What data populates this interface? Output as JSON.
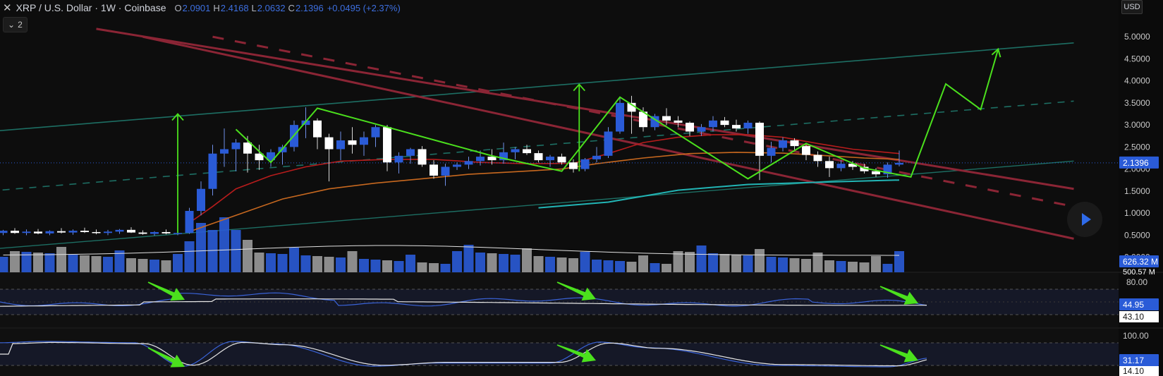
{
  "header": {
    "close_glyph": "✕",
    "symbol": "XRP / U.S. Dollar · 1W · Coinbase",
    "o_label": "O",
    "o_value": "2.0901",
    "h_label": "H",
    "h_value": "2.4168",
    "l_label": "L",
    "l_value": "2.0632",
    "c_label": "C",
    "c_value": "2.1396",
    "change": "+0.0495 (+2.37%)"
  },
  "indicators_toggle": {
    "count": "2",
    "icon": "chevron-down-icon"
  },
  "currency_button": "USD",
  "play_button_icon": "play-icon",
  "colors": {
    "bull": "#2a5bd7",
    "bear": "#ffffff",
    "pattern": "#4be01d",
    "ma_fast": "#b71c1c",
    "ma_slow": "#c7681f",
    "ma_long": "#22b5b5",
    "channel": "#8b2535",
    "support": "#1d6e63",
    "last_price": "#2a5bd7"
  },
  "chart_data": [
    {
      "type": "candlestick",
      "title": "XRP / U.S. Dollar · 1W · Coinbase",
      "y_ticks": [
        "5.0000",
        "4.5000",
        "4.0000",
        "3.5000",
        "3.0000",
        "2.5000",
        "2.0000",
        "1.5000",
        "1.0000",
        "0.5000",
        "0.0000"
      ],
      "ylim": [
        -0.2,
        5.2
      ],
      "last_price": "2.1396",
      "candles": [
        [
          0.55,
          0.62,
          0.5,
          0.6
        ],
        [
          0.6,
          0.66,
          0.53,
          0.55
        ],
        [
          0.55,
          0.63,
          0.5,
          0.58
        ],
        [
          0.58,
          0.64,
          0.52,
          0.54
        ],
        [
          0.54,
          0.61,
          0.5,
          0.59
        ],
        [
          0.59,
          0.66,
          0.54,
          0.56
        ],
        [
          0.56,
          0.63,
          0.51,
          0.6
        ],
        [
          0.6,
          0.67,
          0.55,
          0.57
        ],
        [
          0.57,
          0.63,
          0.52,
          0.55
        ],
        [
          0.55,
          0.62,
          0.5,
          0.58
        ],
        [
          0.58,
          0.64,
          0.53,
          0.62
        ],
        [
          0.62,
          0.68,
          0.55,
          0.56
        ],
        [
          0.56,
          0.61,
          0.51,
          0.53
        ],
        [
          0.53,
          0.59,
          0.49,
          0.57
        ],
        [
          0.57,
          0.63,
          0.52,
          0.54
        ],
        [
          0.54,
          0.6,
          0.5,
          0.55
        ],
        [
          0.55,
          1.12,
          0.53,
          1.05
        ],
        [
          1.05,
          1.72,
          0.95,
          1.55
        ],
        [
          1.55,
          2.55,
          1.4,
          2.35
        ],
        [
          2.35,
          2.92,
          2.05,
          2.45
        ],
        [
          2.45,
          2.68,
          1.95,
          2.6
        ],
        [
          2.6,
          2.75,
          1.92,
          2.35
        ],
        [
          2.35,
          2.55,
          1.98,
          2.2
        ],
        [
          2.2,
          2.45,
          2.05,
          2.38
        ],
        [
          2.38,
          2.55,
          2.1,
          2.5
        ],
        [
          2.5,
          3.1,
          2.4,
          3.0
        ],
        [
          3.0,
          3.4,
          2.7,
          3.1
        ],
        [
          3.1,
          3.15,
          2.45,
          2.72
        ],
        [
          2.72,
          2.8,
          1.72,
          2.45
        ],
        [
          2.45,
          2.85,
          2.2,
          2.65
        ],
        [
          2.65,
          2.95,
          2.35,
          2.55
        ],
        [
          2.55,
          2.85,
          2.3,
          2.72
        ],
        [
          2.72,
          3.0,
          2.5,
          2.95
        ],
        [
          2.95,
          3.0,
          1.95,
          2.15
        ],
        [
          2.15,
          2.38,
          1.9,
          2.3
        ],
        [
          2.3,
          2.48,
          2.12,
          2.45
        ],
        [
          2.45,
          2.52,
          2.05,
          2.1
        ],
        [
          2.1,
          2.2,
          1.78,
          1.85
        ],
        [
          1.85,
          2.12,
          1.62,
          2.05
        ],
        [
          2.05,
          2.15,
          1.98,
          2.1
        ],
        [
          2.1,
          2.28,
          2.0,
          2.18
        ],
        [
          2.18,
          2.42,
          2.08,
          2.28
        ],
        [
          2.28,
          2.45,
          2.1,
          2.2
        ],
        [
          2.2,
          2.6,
          2.12,
          2.38
        ],
        [
          2.38,
          2.5,
          2.22,
          2.45
        ],
        [
          2.45,
          2.55,
          2.32,
          2.36
        ],
        [
          2.36,
          2.42,
          2.15,
          2.2
        ],
        [
          2.2,
          2.32,
          2.05,
          2.28
        ],
        [
          2.28,
          2.35,
          2.1,
          2.15
        ],
        [
          2.15,
          2.22,
          1.92,
          2.0
        ],
        [
          2.0,
          2.25,
          1.95,
          2.22
        ],
        [
          2.22,
          2.5,
          2.15,
          2.3
        ],
        [
          2.3,
          2.95,
          2.25,
          2.85
        ],
        [
          2.85,
          3.62,
          2.8,
          3.5
        ],
        [
          3.5,
          3.66,
          2.8,
          3.3
        ],
        [
          3.3,
          3.4,
          2.85,
          2.95
        ],
        [
          2.95,
          3.25,
          2.88,
          3.2
        ],
        [
          3.2,
          3.38,
          3.0,
          3.1
        ],
        [
          3.1,
          3.2,
          2.95,
          3.05
        ],
        [
          3.05,
          3.08,
          2.75,
          2.85
        ],
        [
          2.85,
          3.02,
          2.75,
          2.95
        ],
        [
          2.95,
          3.2,
          2.85,
          3.1
        ],
        [
          3.1,
          3.18,
          2.95,
          3.0
        ],
        [
          3.0,
          3.12,
          2.85,
          2.92
        ],
        [
          2.92,
          3.1,
          2.8,
          3.05
        ],
        [
          3.05,
          3.08,
          1.75,
          2.3
        ],
        [
          2.3,
          2.62,
          2.15,
          2.48
        ],
        [
          2.48,
          2.72,
          2.4,
          2.65
        ],
        [
          2.65,
          2.7,
          2.42,
          2.52
        ],
        [
          2.52,
          2.55,
          2.2,
          2.32
        ],
        [
          2.32,
          2.4,
          2.05,
          2.18
        ],
        [
          2.18,
          2.28,
          1.82,
          2.02
        ],
        [
          2.02,
          2.2,
          1.95,
          2.12
        ],
        [
          2.12,
          2.18,
          1.98,
          2.05
        ],
        [
          2.05,
          2.12,
          1.9,
          1.95
        ],
        [
          1.95,
          2.02,
          1.82,
          1.88
        ],
        [
          1.88,
          2.15,
          1.8,
          2.1
        ],
        [
          2.1,
          2.42,
          2.06,
          2.14
        ]
      ],
      "ma_fast": [
        [
          16,
          0.78
        ],
        [
          18,
          1.15
        ],
        [
          20,
          1.55
        ],
        [
          23,
          1.85
        ],
        [
          26,
          2.05
        ],
        [
          29,
          2.18
        ],
        [
          33,
          2.22
        ],
        [
          37,
          2.22
        ],
        [
          41,
          2.15
        ],
        [
          45,
          2.12
        ],
        [
          49,
          2.13
        ],
        [
          52,
          2.35
        ],
        [
          55,
          2.6
        ],
        [
          58,
          2.72
        ],
        [
          61,
          2.78
        ],
        [
          64,
          2.78
        ],
        [
          67,
          2.72
        ],
        [
          70,
          2.58
        ],
        [
          73,
          2.45
        ],
        [
          77,
          2.35
        ]
      ],
      "ma_slow": [
        [
          16,
          0.58
        ],
        [
          20,
          0.95
        ],
        [
          24,
          1.32
        ],
        [
          28,
          1.55
        ],
        [
          32,
          1.68
        ],
        [
          36,
          1.78
        ],
        [
          40,
          1.88
        ],
        [
          44,
          1.94
        ],
        [
          48,
          2.0
        ],
        [
          51,
          2.12
        ],
        [
          55,
          2.25
        ],
        [
          59,
          2.35
        ],
        [
          63,
          2.38
        ],
        [
          67,
          2.36
        ],
        [
          71,
          2.3
        ],
        [
          74,
          2.25
        ],
        [
          77,
          2.22
        ]
      ],
      "ma_long": [
        [
          46,
          1.12
        ],
        [
          52,
          1.25
        ],
        [
          58,
          1.52
        ],
        [
          64,
          1.65
        ],
        [
          70,
          1.7
        ],
        [
          77,
          1.75
        ]
      ],
      "support_line": [
        [
          -1.2,
          2.85
        ],
        [
          92,
          4.86
        ]
      ],
      "support_dashed": [
        [
          -1.2,
          1.5
        ],
        [
          92,
          3.54
        ]
      ],
      "support_lower": [
        [
          -1.2,
          0.18
        ],
        [
          92,
          2.18
        ]
      ],
      "channel_upper": [
        [
          8,
          5.18
        ],
        [
          92,
          1.55
        ]
      ],
      "channel_lower": [
        [
          12,
          5.0
        ],
        [
          92,
          0.42
        ]
      ],
      "channel_mid": [
        [
          18,
          5.0
        ],
        [
          92,
          1.15
        ]
      ],
      "pattern_path": [
        [
          20,
          2.9
        ],
        [
          23,
          2.15
        ],
        [
          27,
          3.38
        ],
        [
          33,
          2.95
        ],
        [
          42,
          2.3
        ],
        [
          48,
          1.95
        ],
        [
          53,
          3.63
        ],
        [
          64,
          1.78
        ],
        [
          69,
          2.58
        ],
        [
          74,
          2.02
        ],
        [
          78,
          1.82
        ],
        [
          81,
          3.93
        ],
        [
          84,
          3.35
        ],
        [
          85.5,
          4.72
        ]
      ],
      "arrows_up": [
        [
          15,
          0.55,
          3.25
        ],
        [
          49.5,
          1.95,
          3.92
        ]
      ],
      "volume": {
        "label": "626.32 M",
        "ma_label": "500.57 M"
      }
    },
    {
      "type": "line",
      "name": "rsi",
      "y_ticks": [
        "80.00"
      ],
      "value_labels": [
        "44.95",
        "43.10"
      ]
    },
    {
      "type": "line",
      "name": "stochastic",
      "y_ticks": [
        "100.00"
      ],
      "value_labels": [
        "31.17",
        "14.10"
      ]
    }
  ]
}
